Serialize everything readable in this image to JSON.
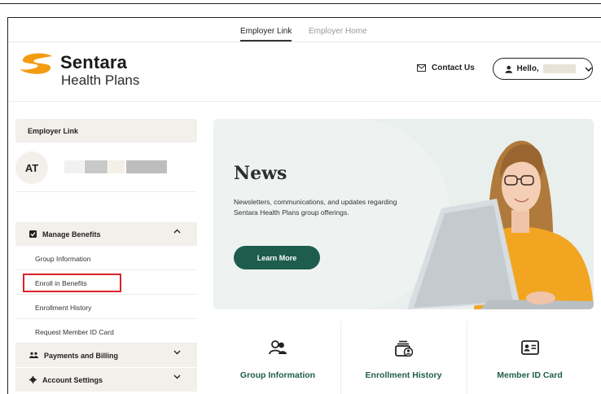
{
  "topnav": {
    "employer_link": "Employer Link",
    "employer_home": "Employer Home"
  },
  "brand": {
    "name": "Sentara",
    "sub": "Health Plans",
    "orange": "#f39c12"
  },
  "header": {
    "contact": "Contact Us",
    "hello": "Hello,"
  },
  "sidebar": {
    "title": "Employer Link",
    "user_initials": "AT",
    "manage": "Manage Benefits",
    "items": [
      "Group Information",
      "Enroll in Benefits",
      "Enrollment History",
      "Request Member ID Card"
    ],
    "payments": "Payments and Billing",
    "account": "Account Settings"
  },
  "hero": {
    "title": "News",
    "desc": "Newsletters, communications, and updates regarding Sentara Health Plans group offerings.",
    "button": "Learn More"
  },
  "cards": [
    "Group Information",
    "Enrollment History",
    "Member ID Card"
  ],
  "colors": {
    "accent": "#1e5d4d",
    "highlight": "#d8232a",
    "panel": "#f3efeb"
  }
}
